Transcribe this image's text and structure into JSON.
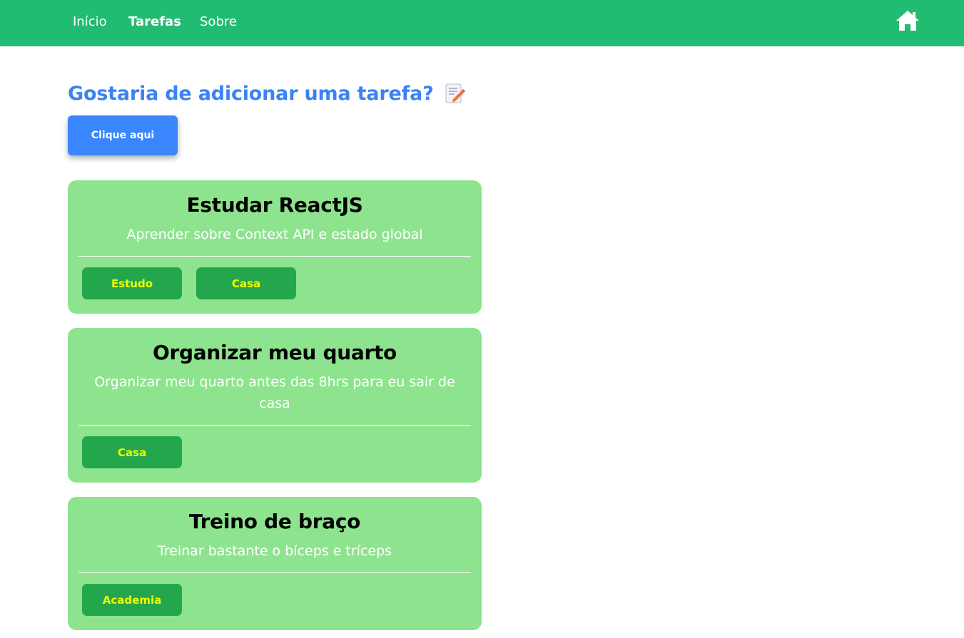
{
  "nav": {
    "links": [
      {
        "label": "Início"
      },
      {
        "label": "Tarefas"
      },
      {
        "label": "Sobre"
      }
    ],
    "home_icon": "home-icon",
    "bg_color": "#22bb72"
  },
  "main": {
    "heading": "Gostaria de adicionar uma tarefa?",
    "heading_icon": "memo-icon",
    "add_button_label": "Clique aqui",
    "accent_color": "#3a86ff"
  },
  "tasks": [
    {
      "title": "Estudar ReactJS",
      "description": "Aprender sobre Context API e estado global",
      "tags": [
        "Estudo",
        "Casa"
      ]
    },
    {
      "title": "Organizar meu quarto",
      "description": "Organizar meu quarto antes das 8hrs para eu sair de casa",
      "tags": [
        "Casa"
      ]
    },
    {
      "title": "Treino de braço",
      "description": "Treinar bastante o bíceps e tríceps",
      "tags": [
        "Academia"
      ]
    }
  ],
  "colors": {
    "card_bg": "#8ee48e",
    "tag_bg": "#24a74c",
    "tag_text": "#f0ff00"
  }
}
